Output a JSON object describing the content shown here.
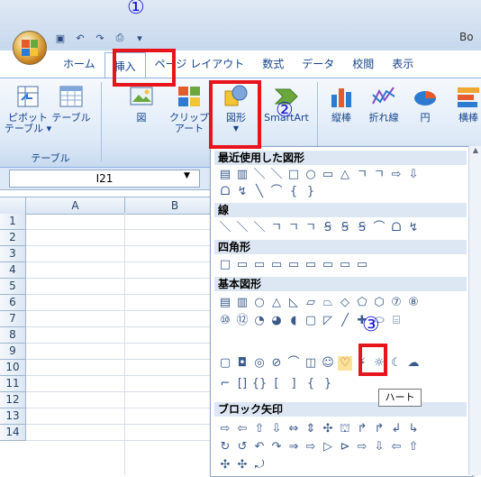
{
  "window": {
    "title": "Bo"
  },
  "qat": {
    "icons": [
      "save-icon",
      "undo-icon",
      "redo-icon",
      "quickprint-icon",
      "customize-icon"
    ]
  },
  "tabs": [
    "ホーム",
    "挿入",
    "ページ レイアウト",
    "数式",
    "データ",
    "校閲",
    "表示"
  ],
  "active_tab": "挿入",
  "ribbon": {
    "pivot": "ピボット\nテーブル ▾",
    "table": "テーブル",
    "group_table": "テーブル",
    "picture": "図",
    "clipart": "クリップ\nアート",
    "shapes": "図形",
    "smartart": "SmartArt",
    "column": "縦棒",
    "line": "折れ線",
    "pie": "円",
    "bar": "横棒"
  },
  "namebox": {
    "value": "I21"
  },
  "grid": {
    "columns": [
      "A",
      "B"
    ],
    "rows": [
      "1",
      "2",
      "3",
      "4",
      "5",
      "6",
      "7",
      "8",
      "9",
      "10",
      "11",
      "12",
      "13",
      "14"
    ]
  },
  "gallery": {
    "sections": [
      {
        "title": "最近使用した図形",
        "rows": [
          [
            "▤",
            "▥",
            "＼",
            "＼",
            "□",
            "○",
            "▭",
            "△",
            "ㄱ",
            "ㄱ",
            "⇨",
            "⇩"
          ],
          [
            "ᗝ",
            "↯",
            "╲",
            "⌒",
            "{",
            "}"
          ]
        ]
      },
      {
        "title": "線",
        "rows": [
          [
            "＼",
            "＼",
            "＼",
            "ㄱ",
            "ㄱ",
            "ㄱ",
            "Ꞩ",
            "Ꞩ",
            "Ꞩ",
            "⌒",
            "ᗝ",
            "↯"
          ]
        ]
      },
      {
        "title": "四角形",
        "rows": [
          [
            "□",
            "▭",
            "▭",
            "▭",
            "▭",
            "▭",
            "▭",
            "▭",
            "▭"
          ]
        ]
      },
      {
        "title": "基本図形",
        "rows": [
          [
            "▤",
            "▥",
            "○",
            "△",
            "◺",
            "▱",
            "⏢",
            "◇",
            "⬠",
            "⬡",
            "⑦",
            "⑧"
          ],
          [
            "⑩",
            "⑫",
            "◔",
            "◕",
            "◖",
            "▢",
            "◸",
            "╱",
            "✚",
            "⬭",
            "⌸"
          ],
          [
            "▢",
            "◘",
            "◎",
            "⊘",
            "⌒",
            "◫",
            "☺",
            "♡",
            "⚡",
            "☼",
            "☾",
            "☁"
          ],
          [
            "⌐",
            "[]",
            "{}",
            "[",
            "]",
            "{",
            "}"
          ]
        ]
      },
      {
        "title": "ブロック矢印",
        "rows": [
          [
            "⇨",
            "⇦",
            "⇧",
            "⇩",
            "⇔",
            "⇕",
            "✣",
            "⛫",
            "↱",
            "↱",
            "↲",
            "↳"
          ],
          [
            "↻",
            "↺",
            "↶",
            "↷",
            "⇒",
            "⇨",
            "▷",
            "⊳",
            "⇨",
            "⇩",
            "⇦",
            "⇧"
          ],
          [
            "✣",
            "✣",
            "⤾"
          ]
        ]
      }
    ]
  },
  "tooltip": {
    "text": "ハート"
  },
  "steps": [
    "①",
    "②",
    "③"
  ],
  "colors": {
    "highlight": "#e8141b",
    "step": "#1a18d6",
    "ribbon_text": "#15428b"
  }
}
